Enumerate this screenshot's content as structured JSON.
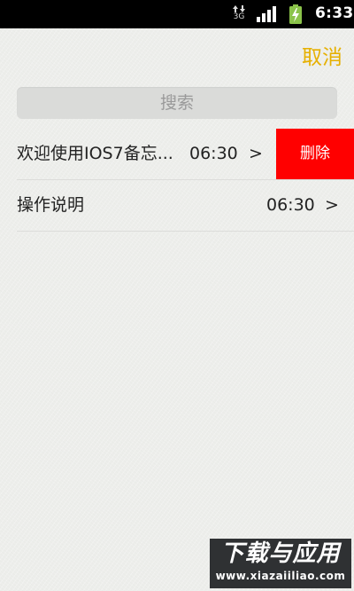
{
  "status_bar": {
    "network_label": "3G",
    "time": "6:33"
  },
  "header": {
    "cancel_label": "取消"
  },
  "search": {
    "placeholder": "搜索"
  },
  "notes": [
    {
      "title": "欢迎使用IOS7备忘...",
      "time": "06:30",
      "chevron": ">",
      "swiped": true
    },
    {
      "title": "操作说明",
      "time": "06:30",
      "chevron": ">",
      "swiped": false
    }
  ],
  "swipe_action": {
    "delete_label": "删除",
    "color": "#ff0000"
  },
  "colors": {
    "accent": "#e6b000",
    "background": "#edeeeb"
  },
  "watermark": {
    "title": "下载与应用",
    "url": "www.xiazaiiliao.com"
  }
}
